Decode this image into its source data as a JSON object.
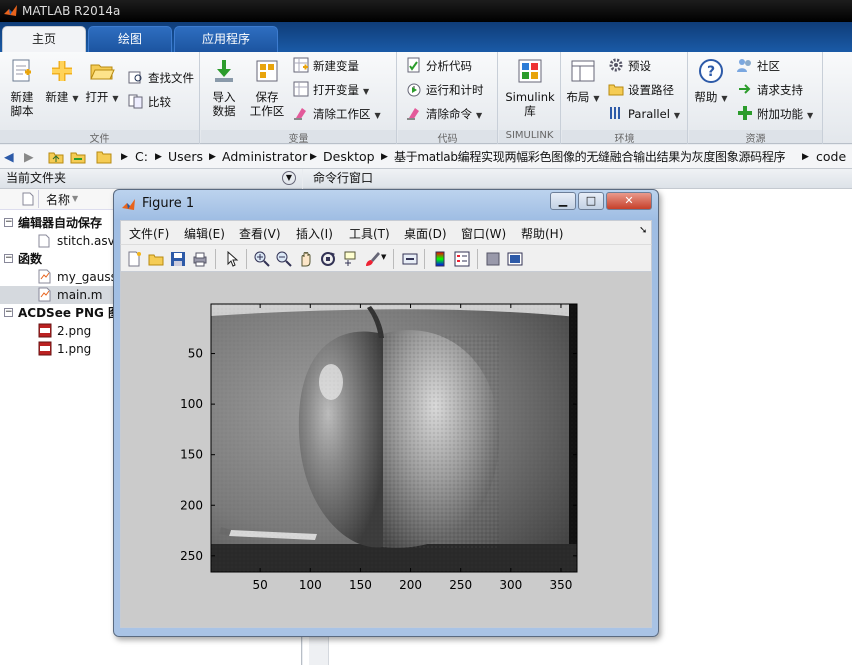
{
  "window": {
    "title": "MATLAB R2014a"
  },
  "tabs": [
    {
      "label": "主页"
    },
    {
      "label": "绘图"
    },
    {
      "label": "应用程序"
    }
  ],
  "ribbon": {
    "file": {
      "new_script": "新建\n脚本",
      "new": "新建",
      "open": "打开",
      "find_files": "查找文件",
      "compare": "比较",
      "label": "文件"
    },
    "variable": {
      "import": "导入\n数据",
      "save_ws": "保存\n工作区",
      "new_var": "新建变量",
      "open_var": "打开变量",
      "clear_ws": "清除工作区",
      "label": "变量"
    },
    "code": {
      "analyze": "分析代码",
      "run_time": "运行和计时",
      "clear_cmd": "清除命令",
      "label": "代码"
    },
    "simulink": {
      "btn": "Simulink\n库",
      "label": "SIMULINK"
    },
    "env": {
      "layout": "布局",
      "prefs": "预设",
      "set_path": "设置路径",
      "parallel": "Parallel",
      "label": "环境"
    },
    "resources": {
      "help": "帮助",
      "community": "社区",
      "support": "请求支持",
      "addons": "附加功能",
      "label": "资源"
    }
  },
  "address": {
    "parts": [
      "C:",
      "Users",
      "Administrator",
      "Desktop",
      "基于matlab编程实现两幅彩色图像的无缝融合输出结果为灰度图象源码程序",
      "code"
    ]
  },
  "left_panel": {
    "title": "当前文件夹",
    "col_name": "名称",
    "groups": [
      {
        "name": "编辑器自动保存",
        "items": [
          "stitch.asv"
        ]
      },
      {
        "name": "函数",
        "items": [
          "my_gauss",
          "main.m"
        ]
      },
      {
        "name": "ACDSee PNG 图",
        "items": [
          "2.png",
          "1.png"
        ]
      }
    ]
  },
  "right_panel": {
    "title": "命令行窗口"
  },
  "figure": {
    "title": "Figure 1",
    "menu": [
      "文件(F)",
      "编辑(E)",
      "查看(V)",
      "插入(I)",
      "工具(T)",
      "桌面(D)",
      "窗口(W)",
      "帮助(H)"
    ],
    "toolbar_icons": [
      "new-figure-icon",
      "open-file-icon",
      "save-icon",
      "print-icon",
      "pointer-icon",
      "zoom-in-icon",
      "zoom-out-icon",
      "pan-icon",
      "rotate-3d-icon",
      "data-cursor-icon",
      "brush-icon",
      "link-plot-icon",
      "colorbar-icon",
      "legend-icon",
      "hide-plot-tools-icon",
      "show-plot-tools-icon"
    ]
  },
  "chart_data": {
    "type": "image",
    "description": "",
    "xticks": [
      50,
      100,
      150,
      200,
      250,
      300,
      350
    ],
    "yticks": [
      50,
      100,
      150,
      200,
      250
    ],
    "xlim": [
      1,
      366
    ],
    "ylim": [
      1,
      266
    ]
  }
}
